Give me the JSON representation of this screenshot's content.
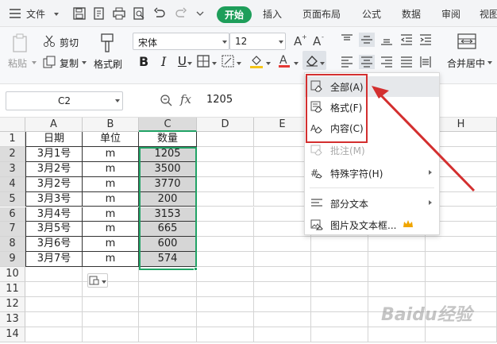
{
  "menubar": {
    "file": "文件",
    "tabs": [
      "开始",
      "插入",
      "页面布局",
      "公式",
      "数据",
      "审阅",
      "视图"
    ],
    "active_tab": "开始",
    "accent": "#1e9e5a"
  },
  "ribbon": {
    "paste": "粘贴",
    "cut": "剪切",
    "copy": "复制",
    "format_painter": "格式刷",
    "font_name": "宋体",
    "font_size": "12",
    "bold": "B",
    "italic": "I",
    "underline": "U",
    "font_color_letter": "A",
    "merge_center": "合并居中"
  },
  "formula_bar": {
    "name_box": "C2",
    "fx": "fx",
    "value": "1205"
  },
  "sheet": {
    "columns": [
      "A",
      "B",
      "C",
      "D",
      "E",
      "F",
      "G",
      "H"
    ],
    "row_numbers": [
      "1",
      "2",
      "3",
      "4",
      "5",
      "6",
      "7",
      "8",
      "9",
      "10",
      "11",
      "12",
      "13",
      "14"
    ],
    "header": [
      "日期",
      "单位",
      "数量"
    ],
    "rows": [
      [
        "3月1号",
        "m",
        "1205"
      ],
      [
        "3月2号",
        "m",
        "3500"
      ],
      [
        "3月2号",
        "m",
        "3770"
      ],
      [
        "3月3号",
        "m",
        "200"
      ],
      [
        "3月4号",
        "m",
        "3153"
      ],
      [
        "3月5号",
        "m",
        "665"
      ],
      [
        "3月6号",
        "m",
        "600"
      ],
      [
        "3月7号",
        "m",
        "574"
      ]
    ]
  },
  "clear_menu": {
    "items": [
      {
        "label": "全部(A)",
        "icon": "eraser-all-icon",
        "enabled": true
      },
      {
        "label": "格式(F)",
        "icon": "eraser-format-icon",
        "enabled": true
      },
      {
        "label": "内容(C)",
        "icon": "eraser-content-icon",
        "enabled": true
      },
      {
        "label": "批注(M)",
        "icon": "comment-icon",
        "enabled": false
      },
      {
        "label": "特殊字符(H)",
        "icon": "special-char-icon",
        "enabled": true,
        "submenu": true
      },
      {
        "label": "部分文本",
        "icon": "partial-text-icon",
        "enabled": true,
        "submenu": true
      },
      {
        "label": "图片及文本框...",
        "icon": "picture-textbox-icon",
        "enabled": true,
        "crown": true
      }
    ]
  },
  "watermark": "Baidu经验",
  "colors": {
    "highlight": "#d32f2f",
    "selection": "#21a366",
    "selected_fill": "#d6d6d6"
  }
}
